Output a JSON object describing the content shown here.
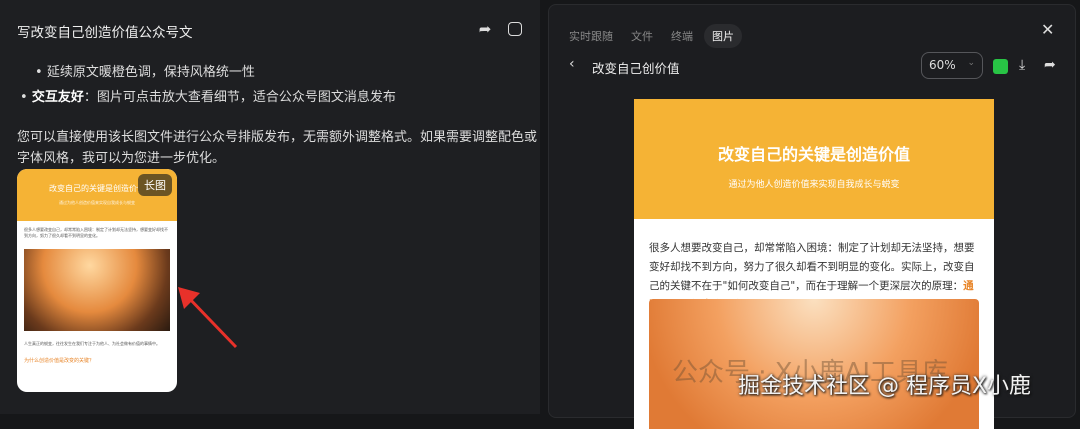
{
  "left": {
    "title": "写改变自己创造价值公众号文",
    "bullets": [
      {
        "text": "延续原文暖橙色调，保持风格统一性"
      },
      {
        "bold": "交互友好",
        "text": "：图片可点击放大查看细节，适合公众号图文消息发布"
      }
    ],
    "paragraph": "您可以直接使用该长图文件进行公众号排版发布，无需额外调整格式。如果需要调整配色或字体风格，我可以为您进一步优化。",
    "thumb": {
      "badge": "长图",
      "title": "改变自己的关键是创造价值",
      "subtitle": "通过为他人创造价值来实现自我成长与蜕变",
      "body": "很多人想要改变自己，却常常陷入困境：制定了计划却无法坚持，想要变好却找不到方向，努力了很久却看不到明显的变化。",
      "body2": "人生真正的蜕变，往往发生在我们专注于为他人、为社会做有价值的事情中。",
      "subheading": "为什么创造价值是改变的关键？"
    }
  },
  "right": {
    "tabs": [
      "实时跟随",
      "文件",
      "终端",
      "图片"
    ],
    "title": "改变自己创价值",
    "zoom": "60%",
    "doc": {
      "title": "改变自己的关键是创造价值",
      "subtitle": "通过为他人创造价值来实现自我成长与蜕变",
      "body": "很多人想要改变自己，却常常陷入困境：制定了计划却无法坚持，想要变好却找不到方向，努力了很久却看不到明显的变化。实际上，改变自己的关键不在于\"如何改变自己\"，而在于理解一个更深层次的原理：",
      "highlight": "通过创造价值来实现自我提升",
      "end": "。"
    }
  },
  "watermark": {
    "wechat": "公众号 · X小鹿AI工具库",
    "juejin": "掘金技术社区 @ 程序员X小鹿"
  },
  "colors": {
    "accent": "#f5b335",
    "highlight": "#e8862a",
    "wechat": "#28c445"
  }
}
